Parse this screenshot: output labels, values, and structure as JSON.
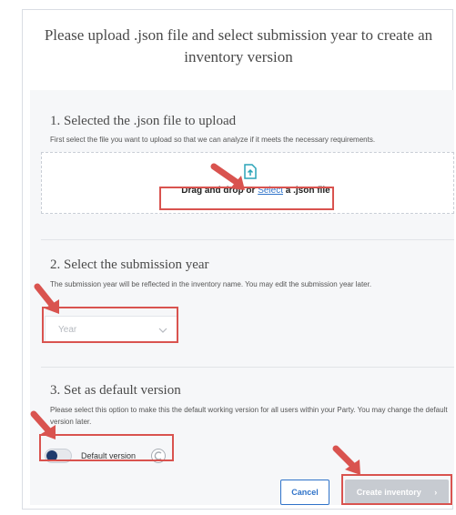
{
  "dialog": {
    "title": "Please upload .json file and select submission year to create an inventory version"
  },
  "step1": {
    "title": "1. Selected the .json file to upload",
    "description": "First select the file you want to upload so that we can analyze if it meets the necessary requirements.",
    "drop_prefix": "Drag and drop or ",
    "drop_link": "Select",
    "drop_suffix": " a .json file"
  },
  "step2": {
    "title": "2. Select the submission year",
    "description": "The submission year will be reflected in the inventory name. You may edit the submission year later.",
    "year_placeholder": "Year"
  },
  "step3": {
    "title": "3. Set as default version",
    "description": "Please select this option to make this the default working version for all users within your Party. You may change the default version later.",
    "toggle_label": "Default version",
    "toggle_on": false
  },
  "actions": {
    "cancel_label": "Cancel",
    "create_label": "Create inventory"
  },
  "colors": {
    "highlight": "#d9534f",
    "link": "#2f73c9",
    "primary_disabled": "#c7cbd1"
  }
}
